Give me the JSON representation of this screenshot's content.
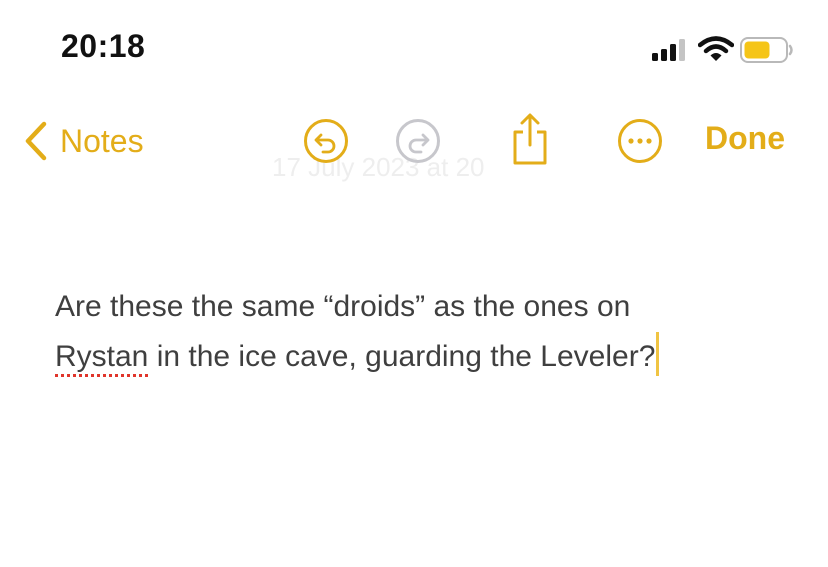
{
  "status_bar": {
    "time": "20:18",
    "icons": [
      "signal-bars-icon",
      "wifi-icon",
      "battery-icon"
    ],
    "battery_color": "#f5c518"
  },
  "toolbar": {
    "back_label": "Notes",
    "done_label": "Done",
    "icons": [
      "chevron-left-icon",
      "undo-icon",
      "redo-icon",
      "share-icon",
      "more-icon"
    ],
    "accent_color": "#e3ad19",
    "disabled_color": "#c7c7cc"
  },
  "note": {
    "date_text": "17 July 2023 at 20",
    "line1": "Are these the same “droids” as the ones on",
    "misspelled_word": "Rystan",
    "line2_rest": " in the ice cave, guarding the Leveler?"
  }
}
